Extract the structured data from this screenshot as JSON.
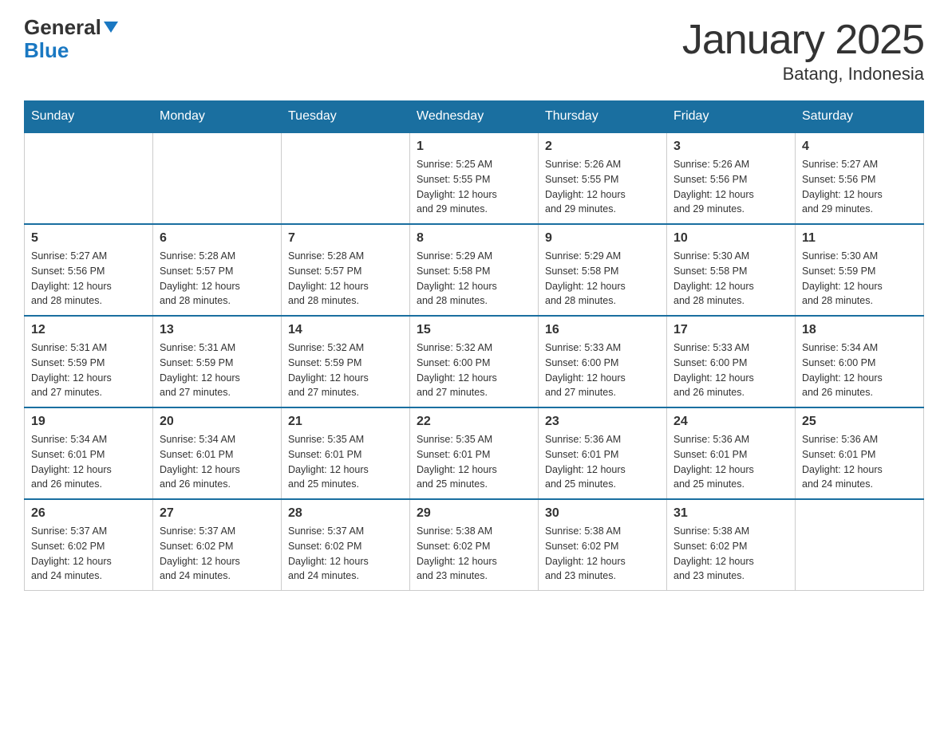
{
  "header": {
    "logo_general": "General",
    "logo_blue": "Blue",
    "title": "January 2025",
    "subtitle": "Batang, Indonesia"
  },
  "calendar": {
    "headers": [
      "Sunday",
      "Monday",
      "Tuesday",
      "Wednesday",
      "Thursday",
      "Friday",
      "Saturday"
    ],
    "weeks": [
      {
        "days": [
          {
            "num": "",
            "info": ""
          },
          {
            "num": "",
            "info": ""
          },
          {
            "num": "",
            "info": ""
          },
          {
            "num": "1",
            "info": "Sunrise: 5:25 AM\nSunset: 5:55 PM\nDaylight: 12 hours\nand 29 minutes."
          },
          {
            "num": "2",
            "info": "Sunrise: 5:26 AM\nSunset: 5:55 PM\nDaylight: 12 hours\nand 29 minutes."
          },
          {
            "num": "3",
            "info": "Sunrise: 5:26 AM\nSunset: 5:56 PM\nDaylight: 12 hours\nand 29 minutes."
          },
          {
            "num": "4",
            "info": "Sunrise: 5:27 AM\nSunset: 5:56 PM\nDaylight: 12 hours\nand 29 minutes."
          }
        ]
      },
      {
        "days": [
          {
            "num": "5",
            "info": "Sunrise: 5:27 AM\nSunset: 5:56 PM\nDaylight: 12 hours\nand 28 minutes."
          },
          {
            "num": "6",
            "info": "Sunrise: 5:28 AM\nSunset: 5:57 PM\nDaylight: 12 hours\nand 28 minutes."
          },
          {
            "num": "7",
            "info": "Sunrise: 5:28 AM\nSunset: 5:57 PM\nDaylight: 12 hours\nand 28 minutes."
          },
          {
            "num": "8",
            "info": "Sunrise: 5:29 AM\nSunset: 5:58 PM\nDaylight: 12 hours\nand 28 minutes."
          },
          {
            "num": "9",
            "info": "Sunrise: 5:29 AM\nSunset: 5:58 PM\nDaylight: 12 hours\nand 28 minutes."
          },
          {
            "num": "10",
            "info": "Sunrise: 5:30 AM\nSunset: 5:58 PM\nDaylight: 12 hours\nand 28 minutes."
          },
          {
            "num": "11",
            "info": "Sunrise: 5:30 AM\nSunset: 5:59 PM\nDaylight: 12 hours\nand 28 minutes."
          }
        ]
      },
      {
        "days": [
          {
            "num": "12",
            "info": "Sunrise: 5:31 AM\nSunset: 5:59 PM\nDaylight: 12 hours\nand 27 minutes."
          },
          {
            "num": "13",
            "info": "Sunrise: 5:31 AM\nSunset: 5:59 PM\nDaylight: 12 hours\nand 27 minutes."
          },
          {
            "num": "14",
            "info": "Sunrise: 5:32 AM\nSunset: 5:59 PM\nDaylight: 12 hours\nand 27 minutes."
          },
          {
            "num": "15",
            "info": "Sunrise: 5:32 AM\nSunset: 6:00 PM\nDaylight: 12 hours\nand 27 minutes."
          },
          {
            "num": "16",
            "info": "Sunrise: 5:33 AM\nSunset: 6:00 PM\nDaylight: 12 hours\nand 27 minutes."
          },
          {
            "num": "17",
            "info": "Sunrise: 5:33 AM\nSunset: 6:00 PM\nDaylight: 12 hours\nand 26 minutes."
          },
          {
            "num": "18",
            "info": "Sunrise: 5:34 AM\nSunset: 6:00 PM\nDaylight: 12 hours\nand 26 minutes."
          }
        ]
      },
      {
        "days": [
          {
            "num": "19",
            "info": "Sunrise: 5:34 AM\nSunset: 6:01 PM\nDaylight: 12 hours\nand 26 minutes."
          },
          {
            "num": "20",
            "info": "Sunrise: 5:34 AM\nSunset: 6:01 PM\nDaylight: 12 hours\nand 26 minutes."
          },
          {
            "num": "21",
            "info": "Sunrise: 5:35 AM\nSunset: 6:01 PM\nDaylight: 12 hours\nand 25 minutes."
          },
          {
            "num": "22",
            "info": "Sunrise: 5:35 AM\nSunset: 6:01 PM\nDaylight: 12 hours\nand 25 minutes."
          },
          {
            "num": "23",
            "info": "Sunrise: 5:36 AM\nSunset: 6:01 PM\nDaylight: 12 hours\nand 25 minutes."
          },
          {
            "num": "24",
            "info": "Sunrise: 5:36 AM\nSunset: 6:01 PM\nDaylight: 12 hours\nand 25 minutes."
          },
          {
            "num": "25",
            "info": "Sunrise: 5:36 AM\nSunset: 6:01 PM\nDaylight: 12 hours\nand 24 minutes."
          }
        ]
      },
      {
        "days": [
          {
            "num": "26",
            "info": "Sunrise: 5:37 AM\nSunset: 6:02 PM\nDaylight: 12 hours\nand 24 minutes."
          },
          {
            "num": "27",
            "info": "Sunrise: 5:37 AM\nSunset: 6:02 PM\nDaylight: 12 hours\nand 24 minutes."
          },
          {
            "num": "28",
            "info": "Sunrise: 5:37 AM\nSunset: 6:02 PM\nDaylight: 12 hours\nand 24 minutes."
          },
          {
            "num": "29",
            "info": "Sunrise: 5:38 AM\nSunset: 6:02 PM\nDaylight: 12 hours\nand 23 minutes."
          },
          {
            "num": "30",
            "info": "Sunrise: 5:38 AM\nSunset: 6:02 PM\nDaylight: 12 hours\nand 23 minutes."
          },
          {
            "num": "31",
            "info": "Sunrise: 5:38 AM\nSunset: 6:02 PM\nDaylight: 12 hours\nand 23 minutes."
          },
          {
            "num": "",
            "info": ""
          }
        ]
      }
    ]
  }
}
